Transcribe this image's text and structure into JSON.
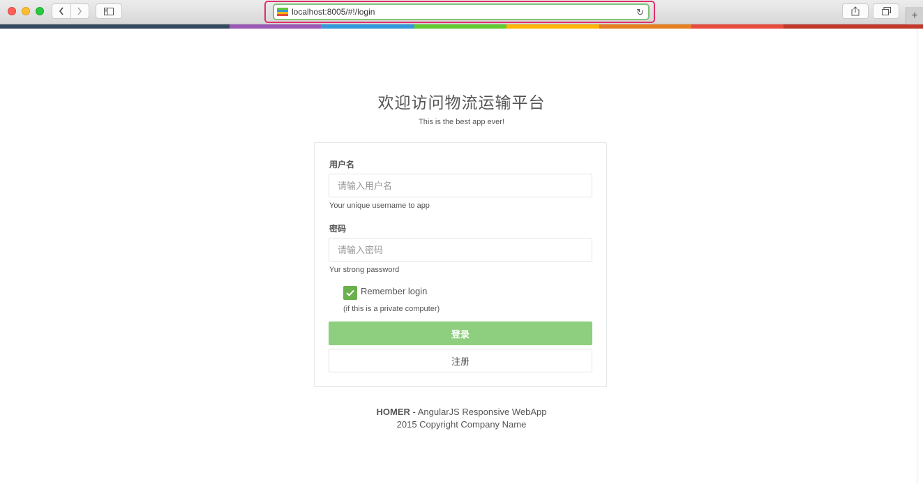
{
  "browser": {
    "url": "localhost:8005/#!/login",
    "back_icon": "chevron-left-icon",
    "forward_icon": "chevron-right-icon",
    "sidebar_icon": "sidebar-icon",
    "share_icon": "share-icon",
    "tabs_icon": "tabs-icon",
    "reload_icon": "reload-icon",
    "newtab_label": "+"
  },
  "colors": {
    "strip": [
      "#34495e",
      "#9b59b6",
      "#3498db",
      "#62cb31",
      "#ffb606",
      "#e67e22",
      "#e74c3c",
      "#c0392b"
    ],
    "login_button": "#8dce7f",
    "checkbox": "#6ab04c"
  },
  "page": {
    "title": "欢迎访问物流运输平台",
    "subtitle": "This is the best app ever!"
  },
  "form": {
    "username_label": "用户名",
    "username_placeholder": "请输入用户名",
    "username_value": "",
    "username_help": "Your unique username to app",
    "password_label": "密码",
    "password_placeholder": "请输入密码",
    "password_value": "",
    "password_help": "Yur strong password",
    "remember_checked": true,
    "remember_label": "Remember login",
    "remember_help": "(if this is a private computer)",
    "login_button": "登录",
    "register_button": "注册"
  },
  "footer": {
    "brand": "HOMER",
    "tagline": " - AngularJS Responsive WebApp",
    "copyright": "2015 Copyright Company Name"
  }
}
